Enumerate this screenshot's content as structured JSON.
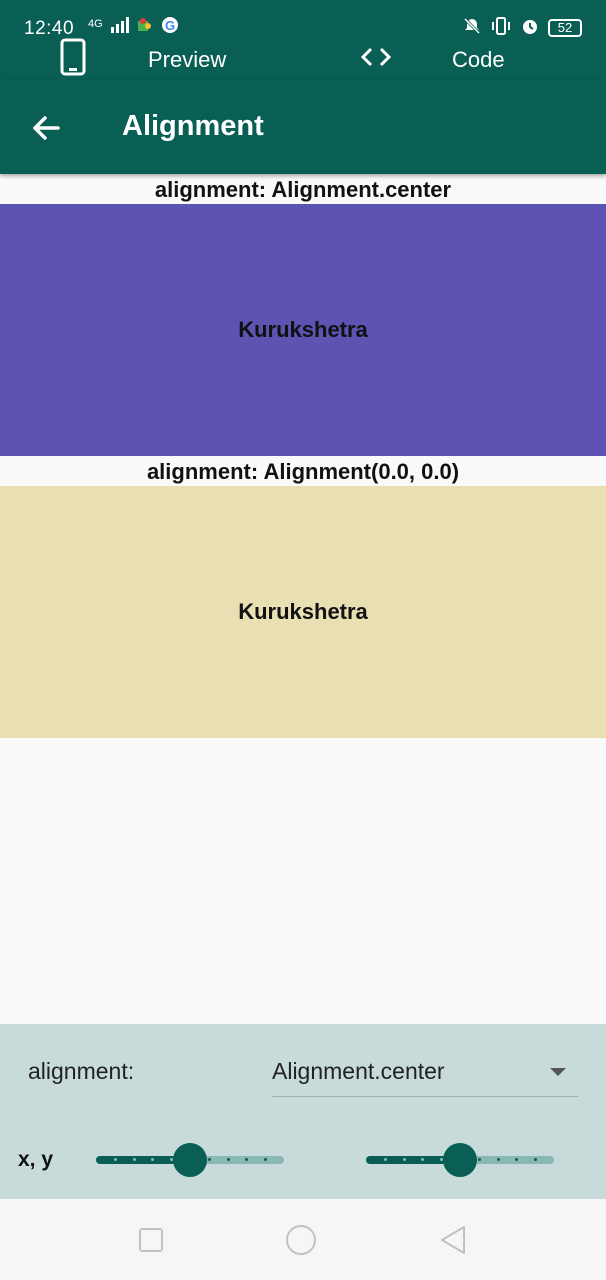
{
  "status_bar": {
    "time": "12:40",
    "network": "4G",
    "battery": "52"
  },
  "tabs": {
    "preview_label": "Preview",
    "code_label": "Code"
  },
  "app_bar": {
    "title": "Alignment"
  },
  "examples": [
    {
      "caption": "alignment: Alignment.center",
      "child_text": "Kurukshetra",
      "color": "#5c53b2"
    },
    {
      "caption": "alignment: Alignment(0.0, 0.0)",
      "child_text": "Kurukshetra",
      "color": "#e8e0b3"
    }
  ],
  "controls": {
    "alignment_label": "alignment:",
    "alignment_value": "Alignment.center",
    "xy_label": "x, y",
    "x_slider_level": 0.5,
    "y_slider_level": 0.5
  },
  "colors": {
    "primary": "#0a5f55",
    "controls_bg": "#c8dbda",
    "slider_inactive": "#87b8b1"
  },
  "icons": {
    "preview": "phone-icon",
    "code": "code-icon",
    "back": "arrow-back-icon",
    "dropdown": "caret-down-icon",
    "nav": [
      "square-icon",
      "circle-icon",
      "triangle-back-icon"
    ]
  }
}
